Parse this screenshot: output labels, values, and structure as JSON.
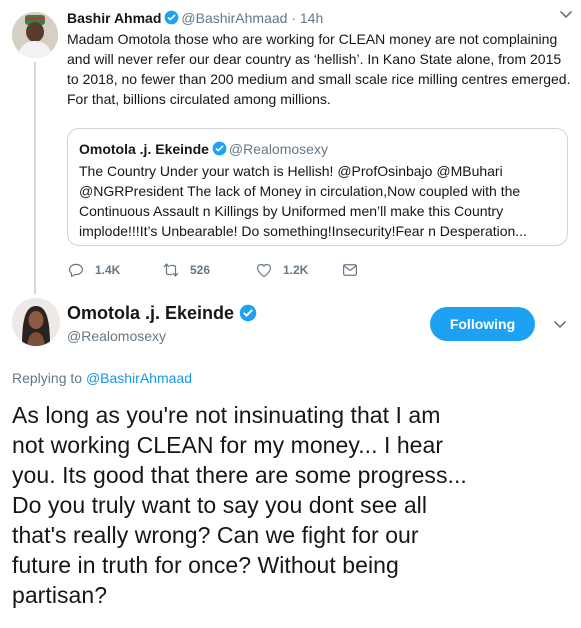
{
  "colors": {
    "accent": "#1da1f2",
    "link": "#1b95e0",
    "muted": "#657786",
    "text": "#14171a"
  },
  "parent_tweet": {
    "author_name": "Bashir Ahmad",
    "author_handle": "@BashirAhmaad",
    "separator": "·",
    "timestamp": "14h",
    "text_lines": [
      "Madam Omotola those who are working for CLEAN money are not complaining",
      "and will never refer our dear country as ‘hellish’. In Kano State alone, from 2015",
      "to 2018, no fewer than 200 medium and small scale rice milling centres emerged.",
      "For that, billions circulated among millions."
    ],
    "quoted_tweet": {
      "author_name": "Omotola .j. Ekeinde",
      "author_handle": "@Realomosexy",
      "text_lines": [
        "The Country Under your watch is Hellish! @ProfOsinbajo @MBuhari",
        "@NGRPresident The lack of Money in circulation,Now coupled with the",
        "Continuous Assault n Killings by Uniformed men’ll make this Country",
        "implode!!!It’s Unbearable! Do something!Insecurity!Fear n Desperation..."
      ]
    },
    "actions": {
      "replies": "1.4K",
      "retweets": "526",
      "likes": "1.2K"
    }
  },
  "main_tweet": {
    "author_name": "Omotola .j. Ekeinde",
    "author_handle": "@Realomosexy",
    "follow_label": "Following",
    "replying_prefix": "Replying to",
    "replying_to": "@BashirAhmaad",
    "text_lines": [
      "As long as you're not insinuating that I am",
      "not working CLEAN for my money... I hear",
      "you. Its good that there are some progress...",
      "Do you truly want to say you dont see all",
      "that's really wrong? Can we fight for our",
      "future in truth for once? Without being",
      "partisan?"
    ]
  },
  "icons": [
    "verified-badge-icon",
    "chevron-down-icon",
    "reply-icon",
    "retweet-icon",
    "like-icon",
    "share-icon"
  ]
}
